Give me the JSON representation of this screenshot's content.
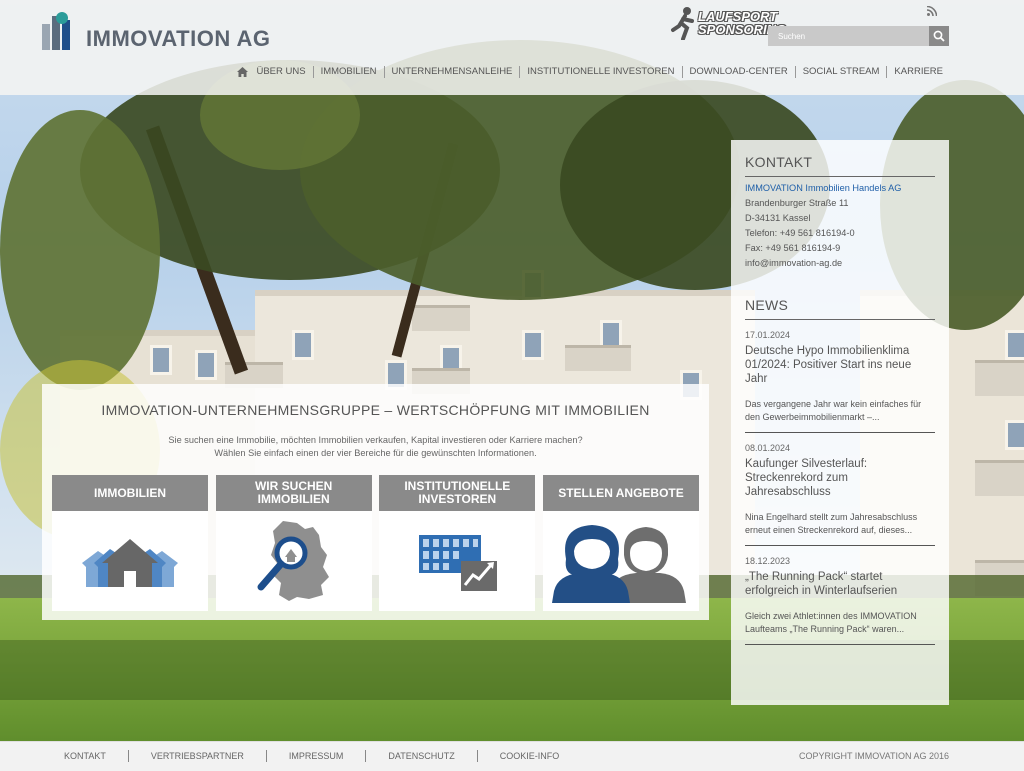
{
  "header": {
    "logo_text": "IMMOVATION AG",
    "sponsor_line1": "LAUFSPORT",
    "sponsor_line2": "SPONSORING",
    "search_placeholder": "Suchen",
    "nav": [
      "ÜBER UNS",
      "IMMOBILIEN",
      "UNTERNEHMENSANLEIHE",
      "INSTITUTIONELLE INVESTOREN",
      "DOWNLOAD-CENTER",
      "SOCIAL STREAM",
      "KARRIERE"
    ]
  },
  "main": {
    "title": "IMMOVATION-UNTERNEHMENSGRUPPE – WERTSCHÖPFUNG MIT IMMOBILIEN",
    "subtitle_line1": "Sie suchen eine Immobilie, möchten Immobilien verkaufen, Kapital investieren oder Karriere machen?",
    "subtitle_line2": "Wählen Sie einfach einen der vier Bereiche für die gewünschten Informationen.",
    "tiles": [
      {
        "label": "IMMOBILIEN",
        "icon": "houses-icon"
      },
      {
        "label": "WIR SUCHEN IMMOBILIEN",
        "icon": "germany-map-search-icon"
      },
      {
        "label": "INSTITUTIONELLE INVESTOREN",
        "icon": "building-chart-icon"
      },
      {
        "label": "STELLEN ANGEBOTE",
        "icon": "people-icon"
      }
    ]
  },
  "sidebar": {
    "contact_heading": "KONTAKT",
    "company": "IMMOVATION Immobilien Handels AG",
    "street": "Brandenburger Straße 11",
    "city": "D-34131 Kassel",
    "phone": "Telefon: +49 561 816194-0",
    "fax": "Fax: +49 561 816194-9",
    "email": "info@immovation-ag.de",
    "news_heading": "NEWS",
    "news": [
      {
        "date": "17.01.2024",
        "title": "Deutsche Hypo Immobilienklima 01/2024: Positiver Start ins neue Jahr",
        "text": "Das vergangene Jahr war kein einfaches für den Gewerbeimmobilienmarkt –..."
      },
      {
        "date": "08.01.2024",
        "title": "Kaufunger Silvesterlauf: Streckenrekord zum Jahresabschluss",
        "text": "Nina Engelhard stellt zum Jahresabschluss erneut einen Streckenrekord auf, dieses..."
      },
      {
        "date": "18.12.2023",
        "title": "„The Running Pack“ startet erfolgreich in Winterlaufserien",
        "text": "Gleich zwei Athlet:innen des IMMOVATION Laufteams „The Running Pack“ waren..."
      }
    ]
  },
  "footer": {
    "links": [
      "KONTAKT",
      "VERTRIEBSPARTNER",
      "IMPRESSUM",
      "DATENSCHUTZ",
      "COOKIE-INFO"
    ],
    "copyright": "COPYRIGHT IMMOVATION AG 2016"
  },
  "colors": {
    "accent_blue": "#1f5fa8",
    "tile_header_gray": "#8a8a8a",
    "icon_blue": "#2b5f9e",
    "icon_gray": "#6e6e6e"
  }
}
